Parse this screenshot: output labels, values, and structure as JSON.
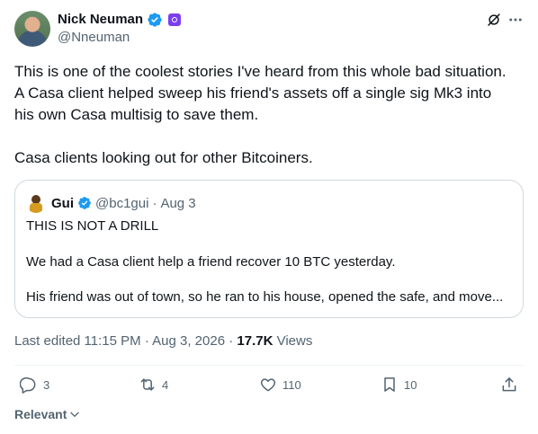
{
  "author": {
    "name": "Nick Neuman",
    "handle": "@Nneuman"
  },
  "icons": {
    "verified": "verified-badge-icon",
    "affiliate": "affiliate-badge-icon",
    "grok": "grok-icon",
    "more": "more-icon",
    "reply": "reply-icon",
    "retweet": "retweet-icon",
    "like": "heart-icon",
    "bookmark": "bookmark-icon",
    "share": "share-icon",
    "chevron": "chevron-down-icon"
  },
  "colors": {
    "verified_blue": "#1d9bf0",
    "affiliate_purple": "#7b3ff2",
    "secondary_text": "#536471",
    "primary_text": "#0f1419",
    "border": "#cfd9de"
  },
  "tweet": {
    "line1": "This is one of the coolest stories I've heard from this whole bad situation.",
    "line2": "A Casa client helped sweep his friend's assets off a single sig Mk3 into",
    "line3": "his own Casa multisig to save them.",
    "line4": "Casa clients looking out for other Bitcoiners."
  },
  "quote": {
    "name": "Gui",
    "handle": "@bc1gui",
    "separator": "·",
    "date": "Aug 3",
    "line1": "THIS IS NOT A DRILL",
    "line2": "We had a Casa client help a friend recover 10 BTC yesterday.",
    "line3": "His friend was out of town, so he ran to his house, opened the safe, and move..."
  },
  "meta": {
    "edited": "Last edited 11:15 PM · Aug 3, 2026 · ",
    "views_count": "17.7K",
    "views_label": " Views"
  },
  "actions": {
    "replies": "3",
    "reposts": "4",
    "likes": "110",
    "bookmarks": "10"
  },
  "sort": {
    "label": "Relevant"
  }
}
